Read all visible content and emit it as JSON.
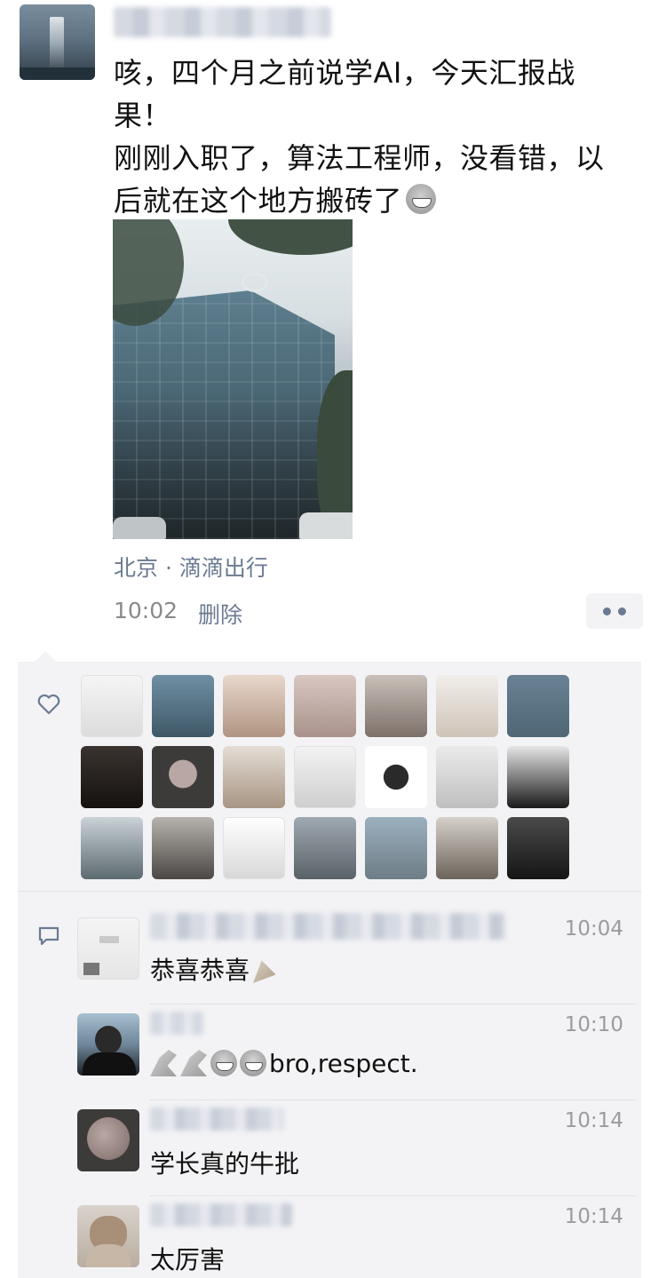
{
  "post": {
    "text_lines": [
      "咳，四个月之前说学AI，今天汇报战",
      "果！",
      "刚刚入职了，算法工程师，没看错，以",
      "后就在这个地方搬砖了"
    ],
    "emoji": "grin-emoji",
    "location": "北京 · 滴滴出行",
    "time": "10:02",
    "delete_label": "删除"
  },
  "likes": {
    "icon": "heart-outline-icon",
    "count": 21
  },
  "comments": [
    {
      "text": "恭喜恭喜",
      "time": "10:04",
      "emoji_suffix": "party-popper-emoji"
    },
    {
      "text": "bro,respect.",
      "time": "10:10",
      "emoji_prefix": [
        "praying-hands",
        "praying-hands",
        "grin",
        "grin"
      ]
    },
    {
      "text": "学长真的牛批",
      "time": "10:14"
    },
    {
      "text": "太厉害",
      "time": "10:14"
    }
  ],
  "colors": {
    "link_blue": "#6b7a92",
    "panel_bg": "#f3f3f5",
    "time_gray": "#8a8a8a"
  }
}
